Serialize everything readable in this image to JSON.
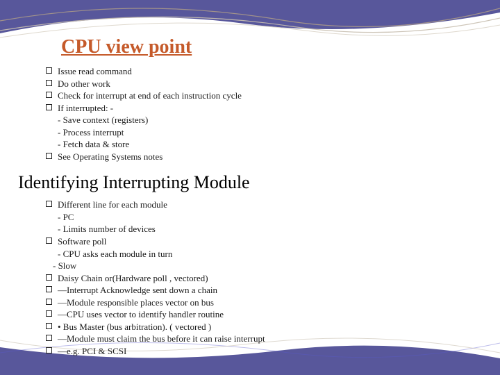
{
  "heading1": "CPU view point",
  "section1": {
    "items": [
      {
        "box": true,
        "text": " Issue read command"
      },
      {
        "box": true,
        "text": "  Do other work"
      },
      {
        "box": true,
        "text": "  Check for interrupt at end of each instruction cycle"
      },
      {
        "box": true,
        "text": "  If interrupted: -"
      },
      {
        "box": false,
        "text": "- Save context (registers)"
      },
      {
        "box": false,
        "text": "- Process interrupt"
      },
      {
        "box": false,
        "text": "- Fetch data & store"
      },
      {
        "box": true,
        "text": "  See Operating Systems notes"
      }
    ]
  },
  "heading2": "Identifying Interrupting Module",
  "section2": {
    "items": [
      {
        "box": true,
        "text": "  Different line for each module"
      },
      {
        "box": false,
        "text": "- PC"
      },
      {
        "box": false,
        "text": "- Limits number of devices"
      },
      {
        "box": true,
        "text": "  Software poll"
      },
      {
        "box": false,
        "text": "- CPU asks each module in turn"
      },
      {
        "box": false,
        "text": "- Slow",
        "shift": true
      },
      {
        "box": true,
        "text": "  Daisy Chain or(Hardware poll , vectored)"
      },
      {
        "box": true,
        "text": "  —Interrupt Acknowledge sent down a chain"
      },
      {
        "box": true,
        "text": "  —Module responsible places vector on bus"
      },
      {
        "box": true,
        "text": "  —CPU uses vector to identify handler routine"
      },
      {
        "box": true,
        "text": "  • Bus Master (bus arbitration). ( vectored )"
      },
      {
        "box": true,
        "text": "  —Module must claim the bus before it can raise interrupt"
      },
      {
        "box": true,
        "text": "  —e.g. PCI & SCSI"
      }
    ]
  }
}
